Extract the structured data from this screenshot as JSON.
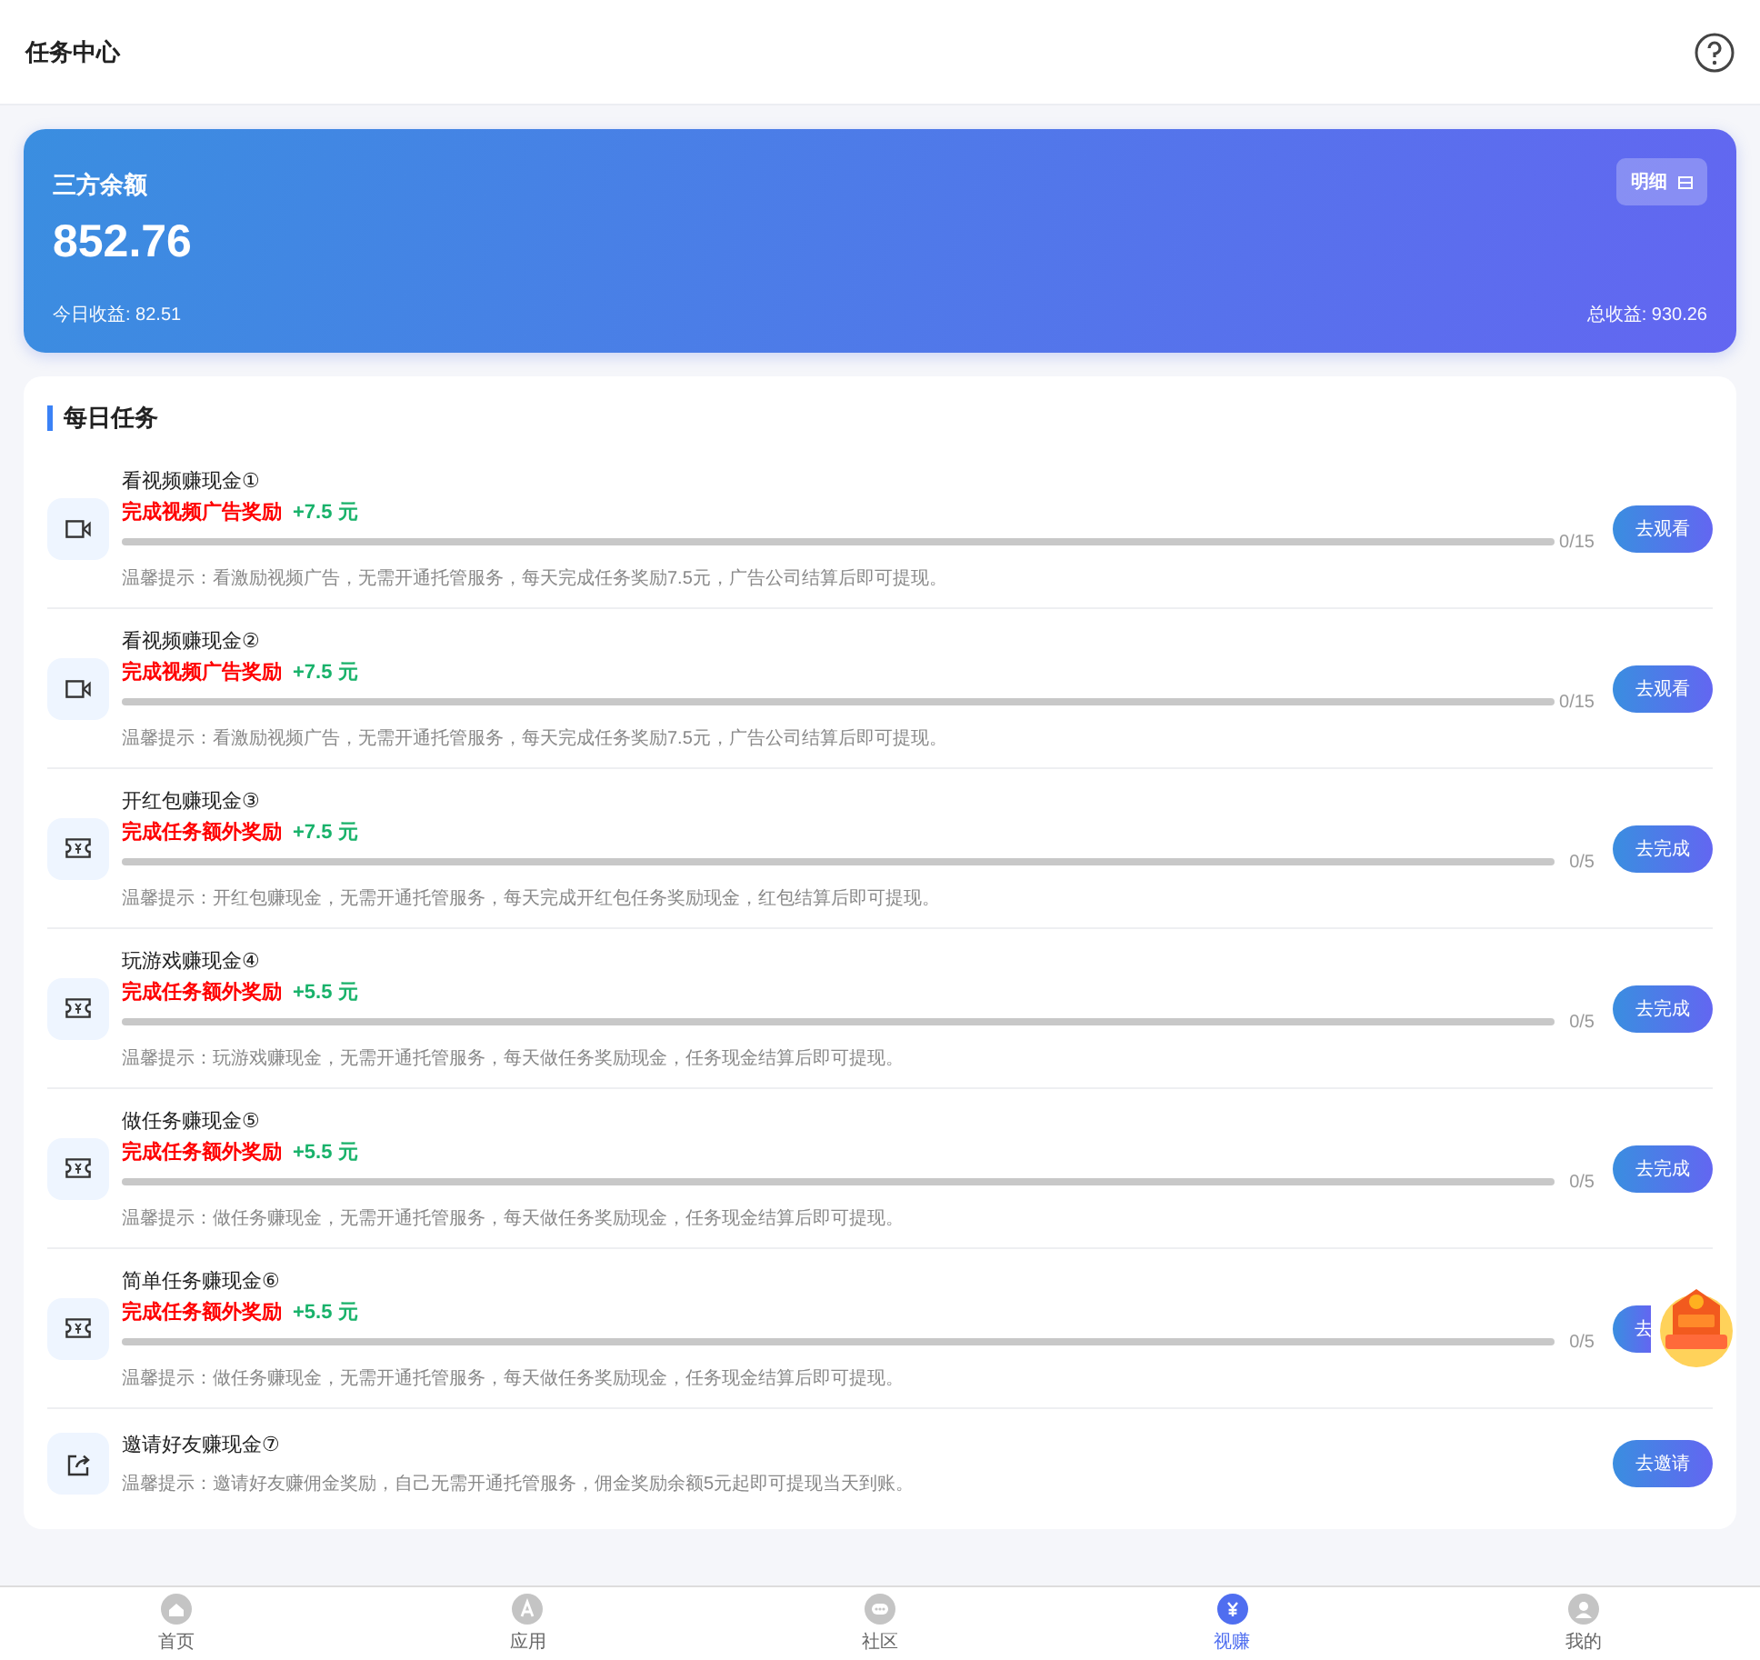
{
  "header": {
    "title": "任务中心"
  },
  "balance": {
    "label": "三方余额",
    "amount": "852.76",
    "detail_button": "明细",
    "today": "今日收益: 82.51",
    "total": "总收益: 930.26"
  },
  "daily_tasks": {
    "heading": "每日任务",
    "tasks": [
      {
        "kind": "video",
        "title": "看视频赚现金①",
        "reward_label": "完成视频广告奖励",
        "reward": "+7.5 元",
        "level": 0,
        "progress": "0/15",
        "hint": "温馨提示：看激励视频广告，无需开通托管服务，每天完成任务奖励7.5元，广告公司结算后即可提现。",
        "button": "去观看"
      },
      {
        "kind": "video",
        "title": "看视频赚现金②",
        "reward_label": "完成视频广告奖励",
        "reward": "+7.5 元",
        "level": 0,
        "progress": "0/15",
        "hint": "温馨提示：看激励视频广告，无需开通托管服务，每天完成任务奖励7.5元，广告公司结算后即可提现。",
        "button": "去观看"
      },
      {
        "kind": "ticket",
        "title": "开红包赚现金③",
        "reward_label": "完成任务额外奖励",
        "reward": "+7.5 元",
        "level": 0,
        "progress": "0/5",
        "hint": "温馨提示：开红包赚现金，无需开通托管服务，每天完成开红包任务奖励现金，红包结算后即可提现。",
        "button": "去完成"
      },
      {
        "kind": "ticket",
        "title": "玩游戏赚现金④",
        "reward_label": "完成任务额外奖励",
        "reward": "+5.5 元",
        "level": 0,
        "progress": "0/5",
        "hint": "温馨提示：玩游戏赚现金，无需开通托管服务，每天做任务奖励现金，任务现金结算后即可提现。",
        "button": "去完成"
      },
      {
        "kind": "ticket",
        "title": "做任务赚现金⑤",
        "reward_label": "完成任务额外奖励",
        "reward": "+5.5 元",
        "level": 0,
        "progress": "0/5",
        "hint": "温馨提示：做任务赚现金，无需开通托管服务，每天做任务奖励现金，任务现金结算后即可提现。",
        "button": "去完成"
      },
      {
        "kind": "ticket",
        "title": "简单任务赚现金⑥",
        "reward_label": "完成任务额外奖励",
        "reward": "+5.5 元",
        "level": 0,
        "progress": "0/5",
        "hint": "温馨提示：做任务赚现金，无需开通托管服务，每天做任务奖励现金，任务现金结算后即可提现。",
        "button": "去",
        "floating_badge": true
      },
      {
        "kind": "share",
        "title": "邀请好友赚现金⑦",
        "hint": "温馨提示：邀请好友赚佣金奖励，自己无需开通托管服务，佣金奖励余额5元起即可提现当天到账。",
        "button": "去邀请"
      }
    ]
  },
  "bottom_nav": [
    {
      "label": "首页",
      "selected": false
    },
    {
      "label": "应用",
      "selected": false
    },
    {
      "label": "社区",
      "selected": false
    },
    {
      "label": "视赚",
      "selected": true
    },
    {
      "label": "我的",
      "selected": false
    }
  ]
}
